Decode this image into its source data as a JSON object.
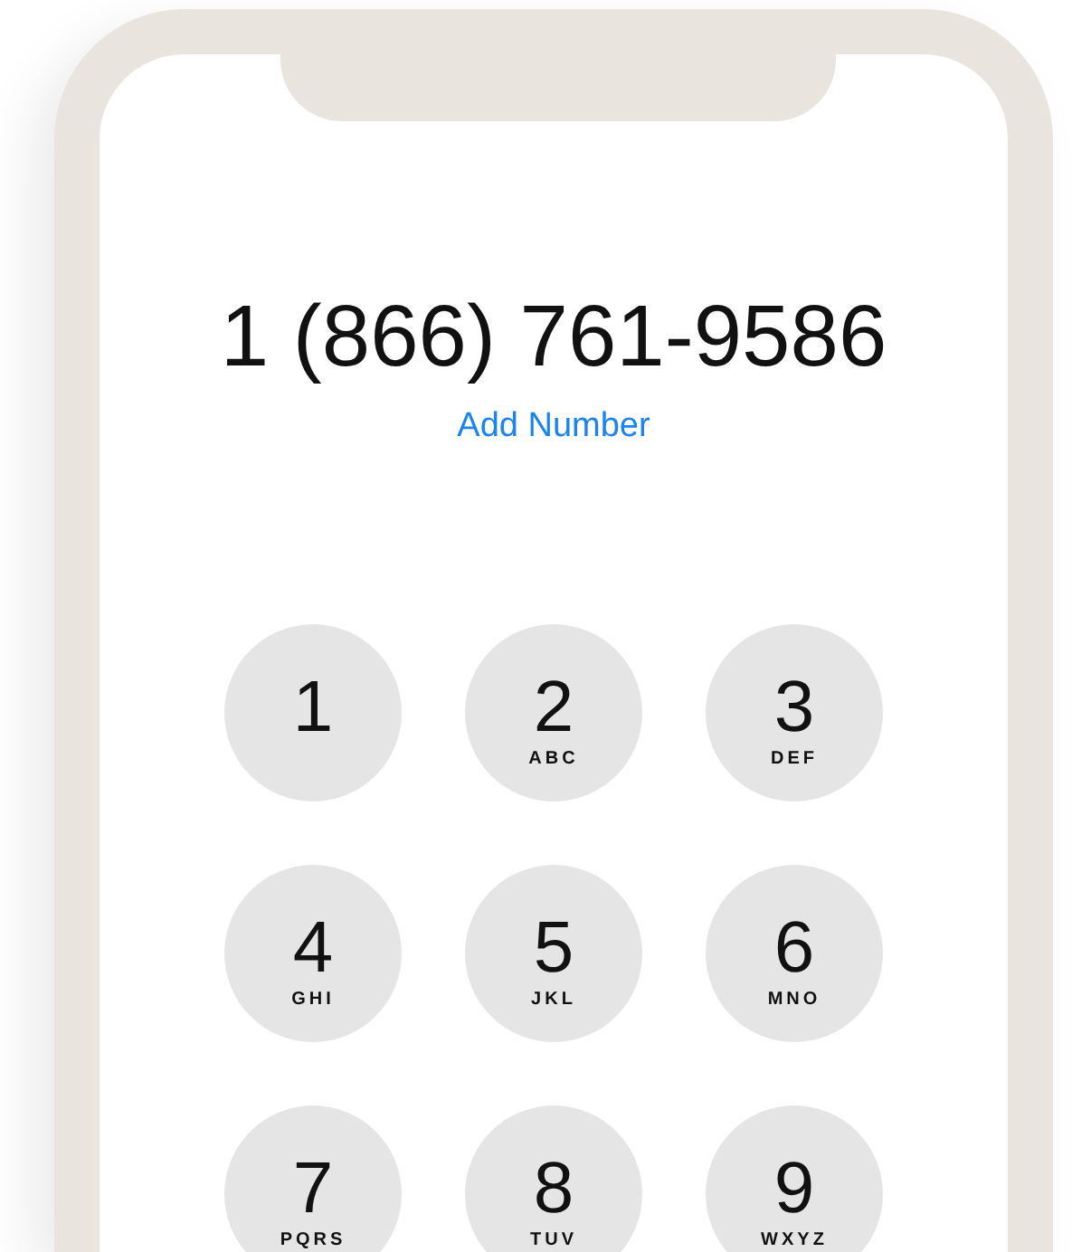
{
  "phone_number": "1 (866) 761-9586",
  "add_number_link": "Add Number",
  "keys": [
    {
      "digit": "1"
    },
    {
      "digit": "2",
      "letters": "ABC"
    },
    {
      "digit": "3",
      "letters": "DEF"
    },
    {
      "digit": "4",
      "letters": "GHI"
    },
    {
      "digit": "5",
      "letters": "JKL"
    },
    {
      "digit": "6",
      "letters": "MNO"
    },
    {
      "digit": "7",
      "letters": "PQRS"
    },
    {
      "digit": "8",
      "letters": "TUV"
    },
    {
      "digit": "9",
      "letters": "WXYZ"
    }
  ]
}
